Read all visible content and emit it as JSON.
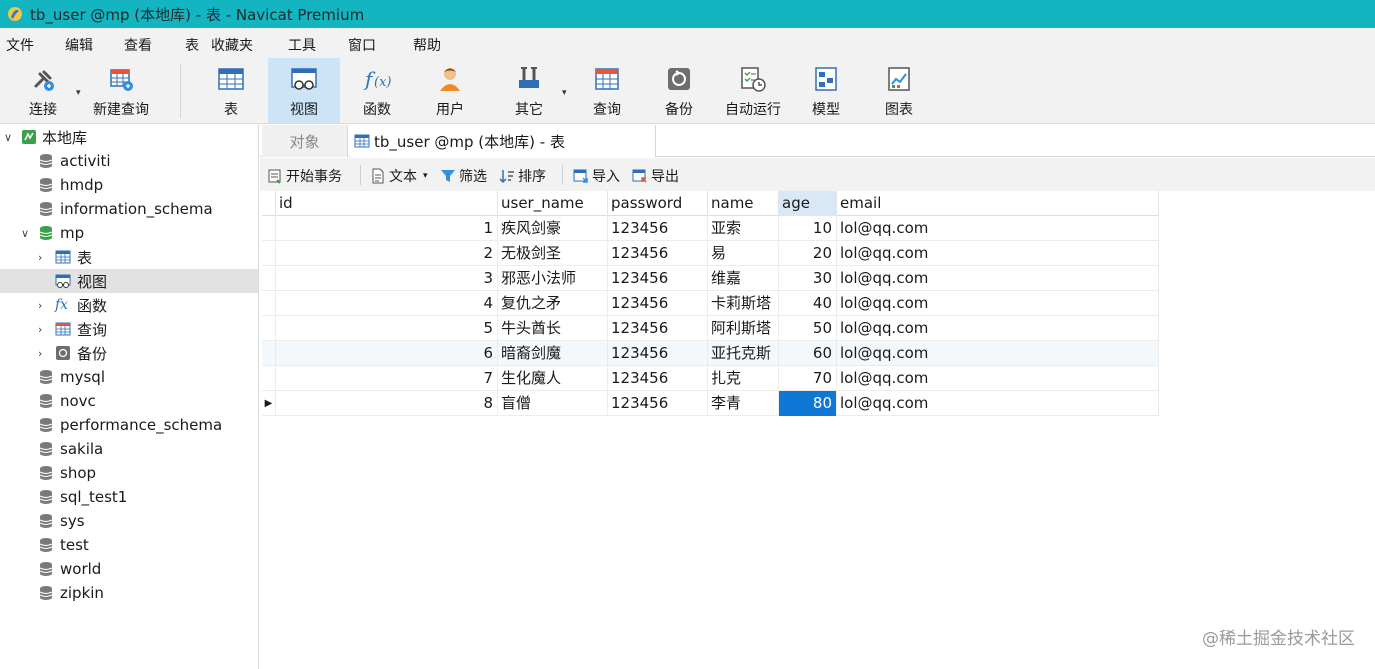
{
  "window": {
    "title": "tb_user @mp (本地库) - 表 - Navicat Premium",
    "accent_color": "#12b5c0"
  },
  "menu": [
    "文件",
    "编辑",
    "查看",
    "表",
    "收藏夹",
    "工具",
    "窗口",
    "帮助"
  ],
  "toolbar": {
    "connect": {
      "label": "连接",
      "icon": "connect-icon"
    },
    "new_query": {
      "label": "新建查询",
      "icon": "new-query-icon"
    },
    "table": {
      "label": "表",
      "icon": "table-icon"
    },
    "view": {
      "label": "视图",
      "icon": "view-icon"
    },
    "function": {
      "label": "函数",
      "icon": "function-icon"
    },
    "user": {
      "label": "用户",
      "icon": "user-icon"
    },
    "other": {
      "label": "其它",
      "icon": "other-icon"
    },
    "query": {
      "label": "查询",
      "icon": "query-icon"
    },
    "backup": {
      "label": "备份",
      "icon": "backup-icon"
    },
    "auto_run": {
      "label": "自动运行",
      "icon": "auto-run-icon"
    },
    "model": {
      "label": "模型",
      "icon": "model-icon"
    },
    "chart": {
      "label": "图表",
      "icon": "chart-icon"
    }
  },
  "sidebar": {
    "root": "本地库",
    "databases_before": [
      "activiti",
      "hmdp",
      "information_schema"
    ],
    "mp": {
      "name": "mp",
      "children": [
        "表",
        "视图",
        "函数",
        "查询",
        "备份"
      ]
    },
    "databases_after": [
      "mysql",
      "novc",
      "performance_schema",
      "sakila",
      "shop",
      "sql_test1",
      "sys",
      "test",
      "world",
      "zipkin"
    ]
  },
  "tabs": {
    "objects": "对象",
    "active": "tb_user @mp (本地库) - 表"
  },
  "subtoolbar": {
    "begin_transaction": "开始事务",
    "text": "文本",
    "filter": "筛选",
    "sort": "排序",
    "import": "导入",
    "export": "导出"
  },
  "grid": {
    "columns": [
      "id",
      "user_name",
      "password",
      "name",
      "age",
      "email"
    ],
    "rows": [
      [
        "1",
        "疾风剑豪",
        "123456",
        "亚索",
        "10",
        "lol@qq.com"
      ],
      [
        "2",
        "无极剑圣",
        "123456",
        "易",
        "20",
        "lol@qq.com"
      ],
      [
        "3",
        "邪恶小法师",
        "123456",
        "维嘉",
        "30",
        "lol@qq.com"
      ],
      [
        "4",
        "复仇之矛",
        "123456",
        "卡莉斯塔",
        "40",
        "lol@qq.com"
      ],
      [
        "5",
        "牛头酋长",
        "123456",
        "阿利斯塔",
        "50",
        "lol@qq.com"
      ],
      [
        "6",
        "暗裔剑魔",
        "123456",
        "亚托克斯",
        "60",
        "lol@qq.com"
      ],
      [
        "7",
        "生化魔人",
        "123456",
        "扎克",
        "70",
        "lol@qq.com"
      ],
      [
        "8",
        "盲僧",
        "123456",
        "李青",
        "80",
        "lol@qq.com"
      ]
    ],
    "selected_color": "#0f78d7"
  },
  "watermark": "@稀土掘金技术社区"
}
